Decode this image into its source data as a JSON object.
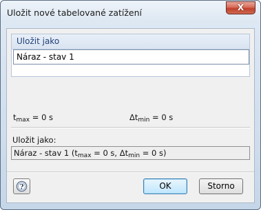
{
  "window": {
    "title": "Uložit nové tabelované zatížení",
    "close_label": "X"
  },
  "save_group": {
    "title": "Uložit jako",
    "name_value": "Náraz - stav 1"
  },
  "info": {
    "tmax_base": "t",
    "tmax_sub": "max",
    "tmax_rest": " = 0 s",
    "dtmin_base": "Δt",
    "dtmin_sub": "min",
    "dtmin_rest": " = 0 s"
  },
  "preview": {
    "label": "Uložit jako:",
    "part1": "Náraz - stav 1 (t",
    "part1_sub": "max",
    "part2": " = 0 s, Δt",
    "part2_sub": "min",
    "part3": " = 0 s)"
  },
  "buttons": {
    "help_icon": "help-icon",
    "ok_label": "OK",
    "cancel_label": "Storno"
  }
}
